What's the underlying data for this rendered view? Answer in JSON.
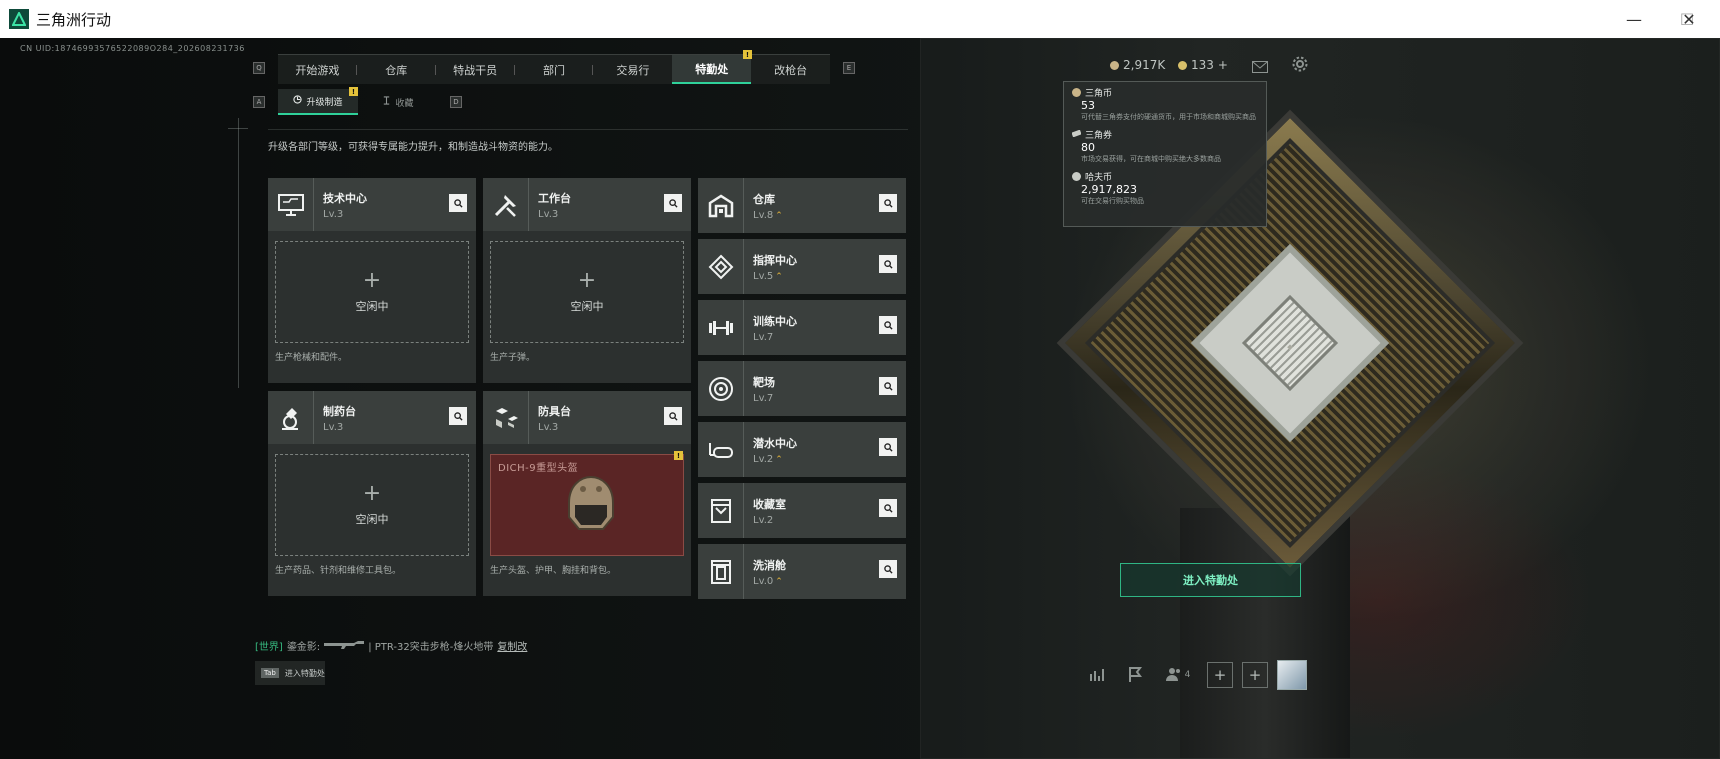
{
  "window": {
    "title": "三角洲行动",
    "minimize": "—",
    "maximize": "☐",
    "close": "✕"
  },
  "uid": "CN UID:18746993576522089O284_202608231736",
  "main_tabs": [
    {
      "label": "开始游戏",
      "active": false
    },
    {
      "label": "仓库",
      "active": false
    },
    {
      "label": "特战干员",
      "active": false
    },
    {
      "label": "部门",
      "active": false
    },
    {
      "label": "交易行",
      "active": false
    },
    {
      "label": "特勤处",
      "active": true
    },
    {
      "label": "改枪台",
      "active": false
    }
  ],
  "key_hints": {
    "prev_tab": "Q",
    "next_tab": "E",
    "prev_sub": "A",
    "next_sub": "D"
  },
  "tab_badge": "!",
  "sub_tabs": [
    {
      "label": "升级制造",
      "active": true,
      "icon": "upgrade-icon"
    },
    {
      "label": "收藏",
      "active": false,
      "icon": "collection-icon"
    }
  ],
  "currency_bar": {
    "coins": "2,917K",
    "tickets": "133",
    "add": "+"
  },
  "tooltip": {
    "items": [
      {
        "name": "三角币",
        "value": "53",
        "desc": "可代替三角券支付的硬通货币，用于市场和商城购买商品"
      },
      {
        "name": "三角券",
        "value": "80",
        "desc": "市场交易获得，可在商城中购买绝大多数商品"
      },
      {
        "name": "哈夫币",
        "value": "2,917,823",
        "desc": "可在交易行购买物品"
      }
    ]
  },
  "intro": "升级各部门等级，可获得专属能力提升，和制造战斗物资的能力。",
  "production_cards": [
    {
      "name": "技术中心",
      "level": "Lv.3",
      "icon": "computer-icon",
      "slot_state": "空闲中",
      "desc": "生产枪械和配件。"
    },
    {
      "name": "工作台",
      "level": "Lv.3",
      "icon": "tools-icon",
      "slot_state": "空闲中",
      "desc": "生产子弹。"
    },
    {
      "name": "制药台",
      "level": "Lv.3",
      "icon": "microscope-icon",
      "slot_state": "空闲中",
      "desc": "生产药品、针剂和维修工具包。"
    },
    {
      "name": "防具台",
      "level": "Lv.3",
      "icon": "cubes-icon",
      "slot_state": "DICH-9重型头盔",
      "desc": "生产头盔、护甲、胸挂和背包。"
    }
  ],
  "facilities": [
    {
      "name": "仓库",
      "level": "Lv.8",
      "upgradable": true,
      "icon": "warehouse-icon"
    },
    {
      "name": "指挥中心",
      "level": "Lv.5",
      "upgradable": true,
      "icon": "command-icon"
    },
    {
      "name": "训练中心",
      "level": "Lv.7",
      "upgradable": false,
      "icon": "dumbbell-icon"
    },
    {
      "name": "靶场",
      "level": "Lv.7",
      "upgradable": false,
      "icon": "target-icon"
    },
    {
      "name": "潜水中心",
      "level": "Lv.2",
      "upgradable": true,
      "icon": "diving-icon"
    },
    {
      "name": "收藏室",
      "level": "Lv.2",
      "upgradable": false,
      "icon": "collection-room-icon"
    },
    {
      "name": "洗消舱",
      "level": "Lv.0",
      "upgradable": true,
      "icon": "decon-icon"
    }
  ],
  "upgrade_glyph": "⌃",
  "enter_button": "进入特勤处",
  "chat": {
    "channel": "[世界]",
    "user": "鎏金影:",
    "message": "| PTR-32突击步枪-烽火地带",
    "link": "复制改"
  },
  "tab_hint": {
    "key": "Tab",
    "label": "进入特勤处"
  },
  "social": {
    "friends_count": "4"
  },
  "colors": {
    "accent": "#2fd19a",
    "badge": "#e4c23a",
    "upgrade": "#e4b53a",
    "helmet_bg": "#5a2525"
  }
}
